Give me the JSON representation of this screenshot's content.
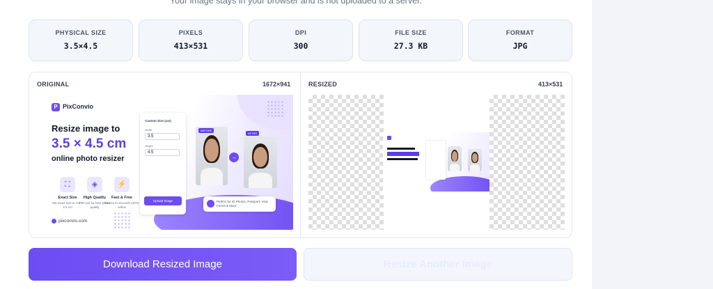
{
  "notice": "Your image stays in your browser and is not uploaded to a server.",
  "stats": [
    {
      "label": "PHYSICAL SIZE",
      "value": "3.5×4.5"
    },
    {
      "label": "PIXELS",
      "value": "413×531"
    },
    {
      "label": "DPI",
      "value": "300"
    },
    {
      "label": "FILE SIZE",
      "value": "27.3 KB"
    },
    {
      "label": "FORMAT",
      "value": "JPG"
    }
  ],
  "preview": {
    "original": {
      "label": "ORIGINAL",
      "dimensions": "1672×941"
    },
    "resized": {
      "label": "RESIZED",
      "dimensions": "413×531"
    }
  },
  "artwork": {
    "brand": "PixConvio",
    "headline_line1": "Resize image to",
    "headline_size": "3.5 × 4.5 cm",
    "headline_line2": "online photo resizer",
    "features": [
      {
        "title": "Exact Size",
        "sub": "Set exact size to 3.5 × 4.5 cm",
        "icon": "crop-icon"
      },
      {
        "title": "High Quality",
        "sub": "Pro tool for best photo quality",
        "icon": "shield-icon"
      },
      {
        "title": "Fast & Free",
        "sub": "Resize in seconds 100% online",
        "icon": "lightning-icon"
      }
    ],
    "site": "pixconvio.com",
    "form": {
      "title": "Custom Size (cm)",
      "width_label": "Width",
      "width_value": "3.5",
      "height_label": "Height",
      "height_value": "4.5",
      "upload": "Upload Image"
    },
    "before_tag": "BEFORE",
    "after_tag": "AFTER",
    "note": "Perfect for ID Photos, Passport, Visa, Forms & More"
  },
  "buttons": {
    "download": "Download Resized Image",
    "another": "Resize Another Image"
  },
  "colors": {
    "accent": "#6d4cf0",
    "panel_bg": "#f3f6fb"
  }
}
